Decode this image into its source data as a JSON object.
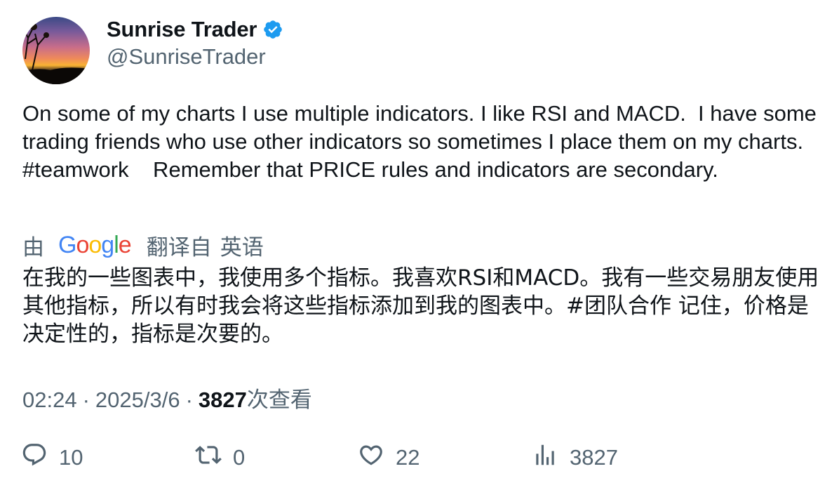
{
  "author": {
    "display_name": "Sunrise Trader",
    "handle": "@SunriseTrader",
    "verified_icon": "verified-badge-icon",
    "verified_color": "#1d9bf0"
  },
  "tweet": {
    "text": "On some of my charts I use multiple indicators. I like RSI and MACD.  I have some trading friends who use other indicators so sometimes I place them on my charts.  #teamwork    Remember that PRICE rules and indicators are secondary."
  },
  "translation": {
    "by_label": "由",
    "provider": "Google",
    "from_label": "翻译自",
    "language": "英语",
    "text": "在我的一些图表中，我使用多个指标。我喜欢RSI和MACD。我有一些交易朋友使用其他指标，所以有时我会将这些指标添加到我的图表中。#团队合作 记住，价格是决定性的，指标是次要的。"
  },
  "meta": {
    "time": "02:24",
    "separator": "·",
    "date": "2025/3/6",
    "views_count": "3827",
    "views_label": "次查看"
  },
  "actions": {
    "reply": {
      "icon": "reply-icon",
      "count": "10"
    },
    "retweet": {
      "icon": "retweet-icon",
      "count": "0"
    },
    "like": {
      "icon": "heart-icon",
      "count": "22"
    },
    "views": {
      "icon": "analytics-icon",
      "count": "3827"
    }
  },
  "colors": {
    "text_primary": "#0f1419",
    "text_secondary": "#536471",
    "accent": "#1d9bf0"
  }
}
